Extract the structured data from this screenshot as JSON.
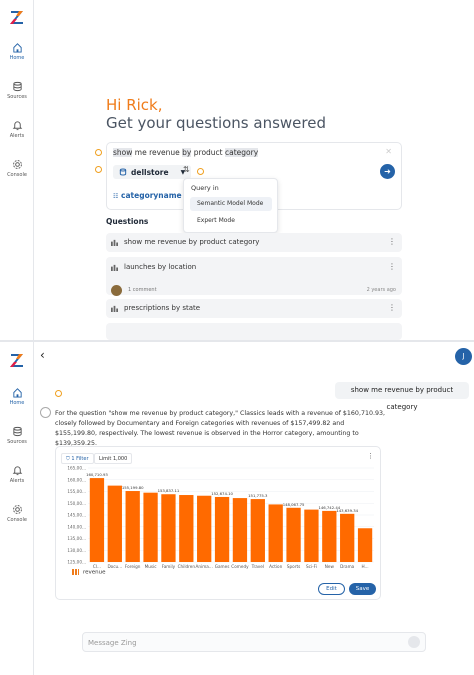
{
  "colors": {
    "accent": "#f07c1a",
    "brand": "#2563a8",
    "bar": "#ff6a00"
  },
  "sidebar": {
    "items": [
      {
        "label": "Home",
        "icon": "home-icon"
      },
      {
        "label": "Sources",
        "icon": "database-icon"
      },
      {
        "label": "Alerts",
        "icon": "bell-icon"
      },
      {
        "label": "Console",
        "icon": "gear-icon"
      }
    ]
  },
  "greeting": {
    "line1": "Hi Rick,",
    "line2": "Get your questions answered"
  },
  "query": {
    "text_parts": [
      {
        "t": "show",
        "hl": true
      },
      {
        "t": " me revenue ",
        "hl": false
      },
      {
        "t": "by",
        "hl": true
      },
      {
        "t": " product ",
        "hl": false
      },
      {
        "t": "category",
        "hl": true
      }
    ],
    "datasource": "dellstore",
    "chip": "categoryname",
    "chip_suffix": "nc"
  },
  "menu": {
    "header": "Query in",
    "items": [
      "Semantic Model Mode",
      "Expert Mode"
    ]
  },
  "questions": {
    "header": "Questions",
    "items": [
      {
        "title": "show me revenue by product category"
      },
      {
        "title": "launches by location",
        "comments": "1 comment",
        "age": "2 years ago"
      },
      {
        "title": "prescriptions by state"
      }
    ]
  },
  "chat": {
    "user_initial": "J",
    "user_message": "show me revenue by product category",
    "answer": "For the question \"show me revenue by product category,\" Classics leads with a revenue of $160,710.93, closely followed by Documentary and Foreign categories with revenues of $157,499.82 and $155,199.80, respectively. The lowest revenue is observed in the Horror category, amounting to $139,359.25.",
    "filter_label": "1 Filter",
    "limit_label": "Limit 1,000",
    "legend": "revenue",
    "edit": "Edit",
    "save": "Save",
    "input_placeholder": "Message Zing"
  },
  "chart_data": {
    "type": "bar",
    "categories": [
      "Cl...",
      "Docu...",
      "Foreign",
      "Music",
      "Family",
      "Children",
      "Anima...",
      "Games",
      "Comedy",
      "Travel",
      "Action",
      "Sports",
      "Sci-Fi",
      "New",
      "Drama",
      "H..."
    ],
    "values": [
      160710.93,
      157499.82,
      155199.8,
      154500,
      153837.11,
      153500,
      153200,
      152674.1,
      152200,
      151775.3,
      149500,
      148067.75,
      147300,
      146742.44,
      145500,
      139359.25
    ],
    "data_labels": [
      "160,710.93",
      "",
      "155,199.80",
      "",
      "153,837.11",
      "",
      "",
      "152,674.10",
      "",
      "151,775.3",
      "",
      "148,067.75",
      "",
      "146,742.44",
      "143,639.34",
      ""
    ],
    "ylim": [
      125000,
      165000
    ],
    "yticks": [
      "165,00...",
      "160,00...",
      "155,00...",
      "150,00...",
      "145,00...",
      "140,00...",
      "135,00...",
      "130,00...",
      "125,00..."
    ],
    "legend": "revenue",
    "grid": true
  }
}
